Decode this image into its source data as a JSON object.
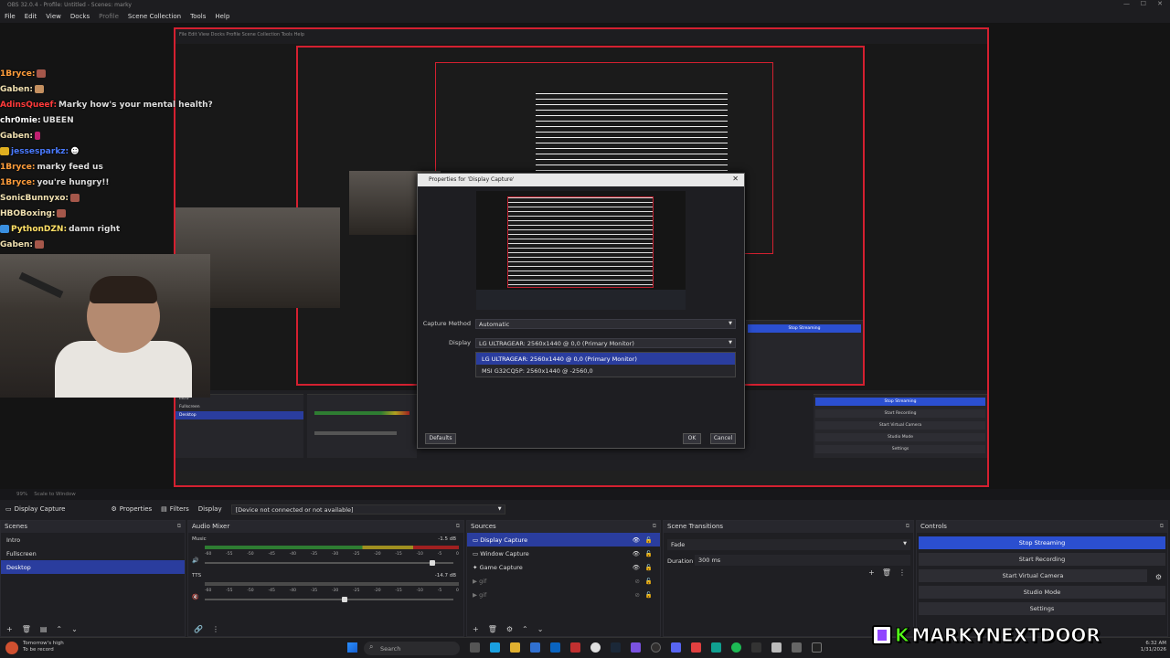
{
  "titlebar": {
    "title": "OBS 32.0.4 - Profile: Untitled - Scenes: marky"
  },
  "menu": [
    "File",
    "Edit",
    "View",
    "Docks",
    "Profile",
    "Scene Collection",
    "Tools",
    "Help"
  ],
  "chat": [
    {
      "user": "1Bryce:",
      "text": "",
      "color": "#ff9d3b"
    },
    {
      "user": "Gaben:",
      "text": "",
      "color": "#f0e0b0"
    },
    {
      "user": "AdinsQueef:",
      "text": "Marky how's your mental health?",
      "color": "#ff3a3a"
    },
    {
      "user": "chr0mie:",
      "text": "UBEEN",
      "color": "#ffffff"
    },
    {
      "user": "Gaben:",
      "text": "",
      "color": "#f0e0b0"
    },
    {
      "user": "jessesparkz:",
      "text": "",
      "color": "#4a7bff"
    },
    {
      "user": "1Bryce:",
      "text": "marky feed us",
      "color": "#ff9d3b"
    },
    {
      "user": "1Bryce:",
      "text": "you're hungry!!",
      "color": "#ff9d3b"
    },
    {
      "user": "SonicBunnyxo:",
      "text": "",
      "color": "#f0e0b0"
    },
    {
      "user": "HBOBoxing:",
      "text": "",
      "color": "#f0e0b0"
    },
    {
      "user": "PythonDZN:",
      "text": "damn right",
      "color": "#ffe066"
    },
    {
      "user": "Gaben:",
      "text": "",
      "color": "#f0e0b0"
    }
  ],
  "dialog": {
    "title": "Properties for 'Display Capture'",
    "capture_method_label": "Capture Method",
    "capture_method_value": "Automatic",
    "display_label": "Display",
    "display_value": "LG ULTRAGEAR: 2560x1440 @ 0,0 (Primary Monitor)",
    "options": [
      "LG ULTRAGEAR: 2560x1440 @ 0,0 (Primary Monitor)",
      "MSI G32CQ5P: 2560x1440 @ -2560,0"
    ],
    "defaults": "Defaults",
    "ok": "OK",
    "cancel": "Cancel"
  },
  "scaler": {
    "zoom": "99%",
    "mode": "Scale to Window"
  },
  "toolbar": {
    "source": "Display Capture",
    "properties": "Properties",
    "filters": "Filters",
    "display_label": "Display",
    "display_value": "[Device not connected or not available]"
  },
  "scenes": {
    "title": "Scenes",
    "items": [
      "Intro",
      "Fullscreen",
      "Desktop"
    ],
    "selected": 2
  },
  "mixer": {
    "title": "Audio Mixer",
    "tracks": [
      {
        "name": "Music",
        "db": "-1.5 dB"
      },
      {
        "name": "TTS",
        "db": "-14.7 dB"
      }
    ],
    "scale": [
      "-60",
      "-55",
      "-50",
      "-45",
      "-40",
      "-35",
      "-30",
      "-25",
      "-20",
      "-15",
      "-10",
      "-5",
      "0"
    ]
  },
  "sources": {
    "title": "Sources",
    "items": [
      "Display Capture",
      "Window Capture",
      "Game Capture",
      "gif",
      "gif"
    ],
    "selected": 0
  },
  "transitions": {
    "title": "Scene Transitions",
    "type": "Fade",
    "duration_label": "Duration",
    "duration": "300 ms"
  },
  "controls": {
    "title": "Controls",
    "buttons": [
      "Stop Streaming",
      "Start Recording",
      "Start Virtual Camera",
      "Studio Mode",
      "Settings"
    ]
  },
  "taskbar": {
    "weather_title": "Tomorrow's high",
    "weather_sub": "To be record",
    "search": "Search",
    "time": "6:32 AM",
    "date": "1/31/2026"
  },
  "brand": {
    "k": "K",
    "name": "MARKYNEXTDOOR"
  },
  "inner": {
    "menu": "File  Edit  View  Docks  Profile  Scene Collection  Tools  Help",
    "controls": [
      "Stop Streaming",
      "Start Recording",
      "Start Virtual Camera",
      "Studio Mode",
      "Settings"
    ],
    "scenes": [
      "Intro",
      "Fullscreen",
      "Desktop"
    ]
  },
  "colors": {
    "accent": "#2a3d9e",
    "stream": "#2b4fd0",
    "border_red": "#d42030"
  }
}
